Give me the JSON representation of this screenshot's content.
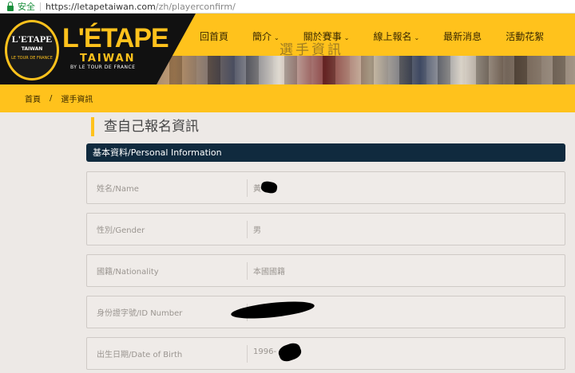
{
  "browser": {
    "secure_label": "安全",
    "url_host": "https://letapetaiwan.com",
    "url_path": "/zh/playerconfirm/"
  },
  "logo": {
    "badge_title": "L'ETAPE",
    "badge_sub": "TAIWAN",
    "badge_small": "LE TOUR DE FRANCE",
    "brand": "L'ÉTAPE",
    "brand_sub": "TAIWAN",
    "brand_tag": "BY LE TOUR DE FRANCE"
  },
  "banner_text": "選手資訊",
  "nav": {
    "items": [
      {
        "label": "回首頁",
        "has_dropdown": false
      },
      {
        "label": "簡介",
        "has_dropdown": true
      },
      {
        "label": "關於賽事",
        "has_dropdown": true
      },
      {
        "label": "線上報名",
        "has_dropdown": true
      },
      {
        "label": "最新消息",
        "has_dropdown": false
      },
      {
        "label": "活動花絮",
        "has_dropdown": false
      }
    ]
  },
  "breadcrumb": {
    "home": "首頁",
    "separator": "/",
    "current": "選手資訊"
  },
  "page_title": "查自己報名資訊",
  "section": {
    "title": "基本資料/Personal Information"
  },
  "fields": [
    {
      "label": "姓名/Name",
      "value": "黃"
    },
    {
      "label": "性別/Gender",
      "value": "男"
    },
    {
      "label": "國籍/Nationality",
      "value": "本國國籍"
    },
    {
      "label": "身份證字號/ID Number",
      "value": ""
    },
    {
      "label": "出生日期/Date of Birth",
      "value": "1996-"
    }
  ],
  "colors": {
    "accent_yellow": "#ffc21c",
    "section_navy": "#102a3e",
    "page_bg": "#ede9e6"
  }
}
